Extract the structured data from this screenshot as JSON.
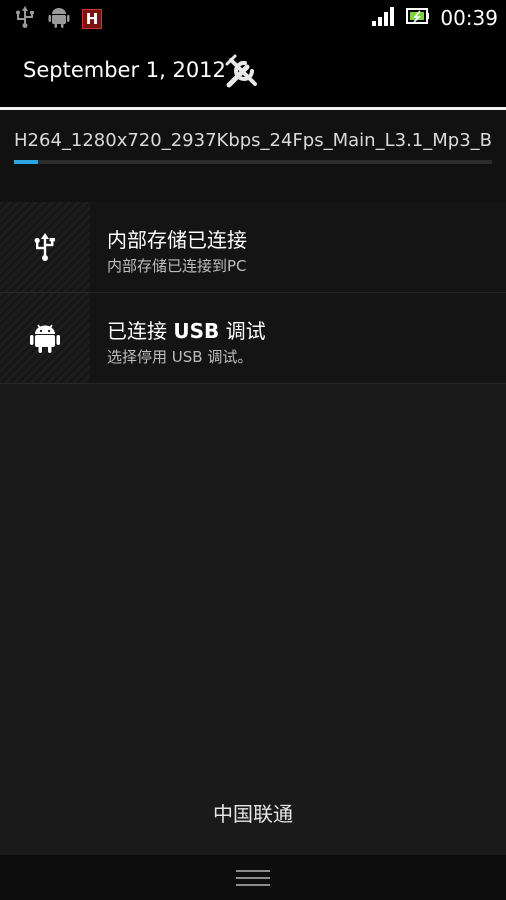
{
  "status_bar": {
    "left_icons": [
      "usb-icon",
      "android-debug-icon",
      "video-app-icon"
    ],
    "video_app_letter": "H",
    "right_icons": [
      "signal-icon",
      "battery-icon"
    ],
    "time": "00:39"
  },
  "header": {
    "date": "September 1, 2012",
    "settings_icon": "settings-tools-icon"
  },
  "ongoing": {
    "file_name": "H264_1280x720_2937Kbps_24Fps_Main_L3.1_Mp3_B",
    "progress": 0.05,
    "accent_color": "#2aa3e0"
  },
  "notifications": [
    {
      "icon": "usb-icon",
      "title": "内部存储已连接",
      "subtitle": "内部存储已连接到PC"
    },
    {
      "icon": "android-icon",
      "title_prefix": "已连接 ",
      "title_bold": "USB",
      "title_suffix": " 调试",
      "subtitle": "选择停用 USB 调试。"
    }
  ],
  "footer": {
    "carrier": "中国联通",
    "handle_icon": "drag-handle-icon"
  }
}
